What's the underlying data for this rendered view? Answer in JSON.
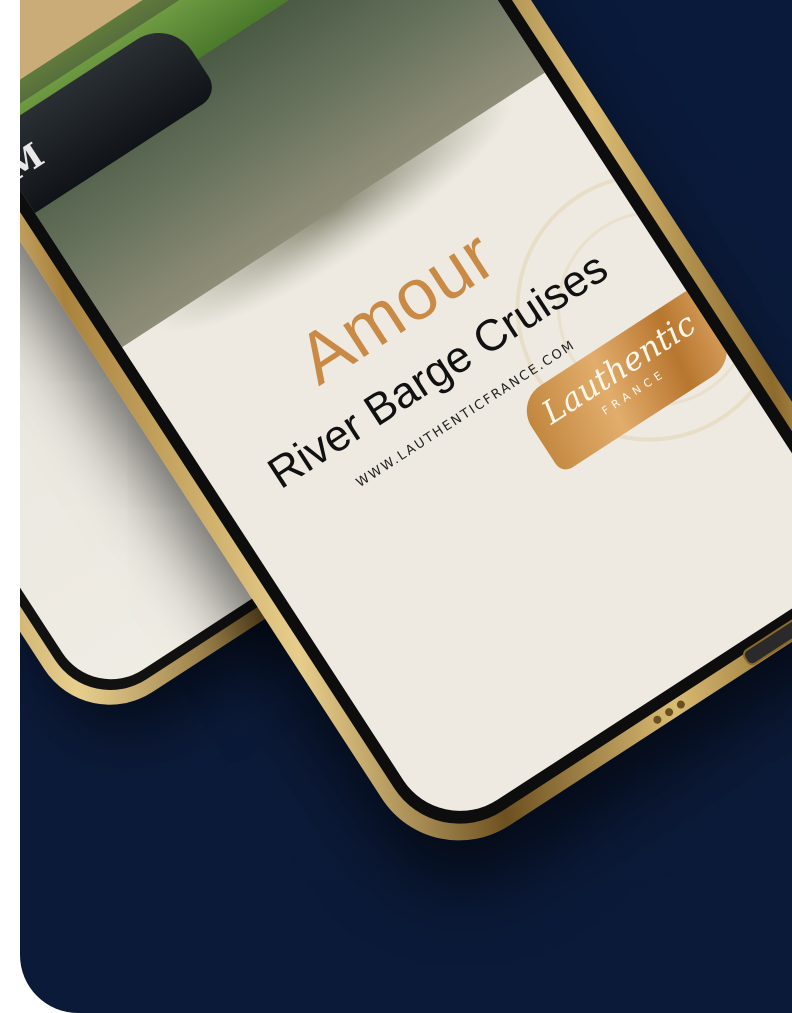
{
  "screen": {
    "title": "Amour",
    "subtitle": "River Barge Cruises",
    "url": "WWW.LAUTHENTICFRANCE.COM"
  },
  "logo": {
    "name": "Lauthentic",
    "sub": "FRANCE"
  },
  "barge_logo": "M",
  "colors": {
    "background": "#0a1a3a",
    "accent": "#c98a46",
    "phone_gold": "#d9bb73"
  }
}
